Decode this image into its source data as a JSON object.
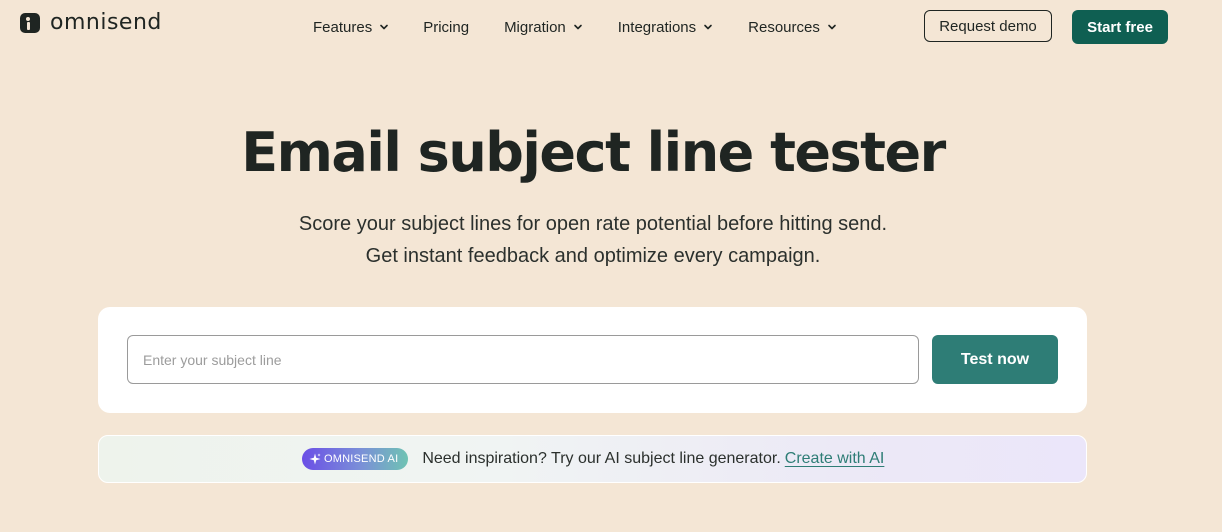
{
  "header": {
    "logo_text": "omnisend",
    "nav": [
      {
        "label": "Features"
      },
      {
        "label": "Pricing"
      },
      {
        "label": "Migration"
      },
      {
        "label": "Integrations"
      },
      {
        "label": "Resources"
      }
    ],
    "request_demo_label": "Request demo",
    "start_free_label": "Start free"
  },
  "hero": {
    "title": "Email subject line tester",
    "subtitle_line1": "Score your subject lines for open rate potential before hitting send.",
    "subtitle_line2": "Get instant feedback and optimize every campaign."
  },
  "tester": {
    "input_placeholder": "Enter your subject line",
    "input_value": "",
    "button_label": "Test now"
  },
  "ai_banner": {
    "badge_label": "OMNISEND AI",
    "text": "Need inspiration? Try our AI subject line generator.",
    "link_label": "Create with AI"
  },
  "colors": {
    "page_background": "#f4e6d5",
    "primary_dark_green": "#0f5f52",
    "button_teal": "#2e7d76",
    "text_dark": "#1f2522"
  },
  "icons": {
    "logo": "omnisend-logo-icon",
    "nav_dropdown": "chevron-down-icon",
    "ai_badge": "sparkle-icon"
  }
}
